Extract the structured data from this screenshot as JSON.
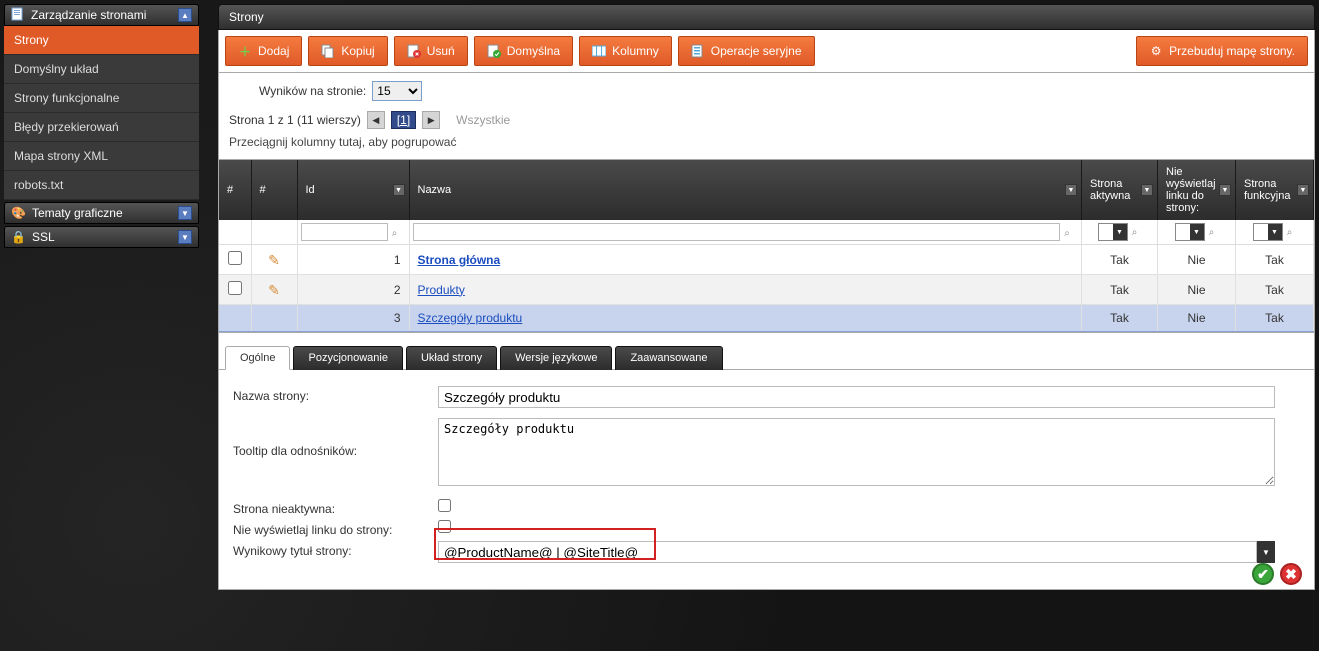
{
  "sidebar": {
    "header": "Zarządzanie stronami",
    "items": [
      "Strony",
      "Domyślny układ",
      "Strony funkcjonalne",
      "Błędy przekierowań",
      "Mapa strony XML",
      "robots.txt"
    ],
    "active_index": 0,
    "panels": [
      {
        "label": "Tematy graficzne"
      },
      {
        "label": "SSL"
      }
    ]
  },
  "main": {
    "title": "Strony",
    "toolbar": {
      "add": "Dodaj",
      "copy": "Kopiuj",
      "delete": "Usuń",
      "default": "Domyślna",
      "columns": "Kolumny",
      "batch": "Operacje seryjne",
      "rebuild": "Przebuduj mapę strony."
    },
    "results": {
      "label": "Wyników na stronie:",
      "value": "15"
    },
    "pager": {
      "text": "Strona 1 z 1 (11 wierszy)",
      "current": "[1]",
      "all": "Wszystkie"
    },
    "group_hint": "Przeciągnij kolumny tutaj, aby pogrupować",
    "columns": {
      "idx1": "#",
      "idx2": "#",
      "id": "Id",
      "name": "Nazwa",
      "active": "Strona aktywna",
      "hide": "Nie wyświetlaj linku do strony:",
      "func": "Strona funkcyjna"
    },
    "rows": [
      {
        "id": "1",
        "name": "Strona główna",
        "bold": true,
        "active": "Tak",
        "hide": "Nie",
        "func": "Tak",
        "edit": true,
        "check": true
      },
      {
        "id": "2",
        "name": "Produkty",
        "bold": false,
        "active": "Tak",
        "hide": "Nie",
        "func": "Tak",
        "edit": true,
        "check": true,
        "alt": true
      },
      {
        "id": "3",
        "name": "Szczegóły produktu",
        "bold": false,
        "active": "Tak",
        "hide": "Nie",
        "func": "Tak",
        "edit": false,
        "check": false,
        "sel": true
      }
    ],
    "tabs": {
      "items": [
        "Ogólne",
        "Pozycjonowanie",
        "Układ strony",
        "Wersje językowe",
        "Zaawansowane"
      ],
      "active_index": 0
    },
    "form": {
      "name_label": "Nazwa strony:",
      "name_value": "Szczegóły produktu",
      "tooltip_label": "Tooltip dla odnośników:",
      "tooltip_value": "Szczegóły produktu",
      "inactive_label": "Strona nieaktywna:",
      "inactive_value": false,
      "hide_label": "Nie wyświetlaj linku do strony:",
      "hide_value": false,
      "result_title_label": "Wynikowy tytuł strony:",
      "result_title_value": "@ProductName@ | @SiteTitle@"
    }
  }
}
